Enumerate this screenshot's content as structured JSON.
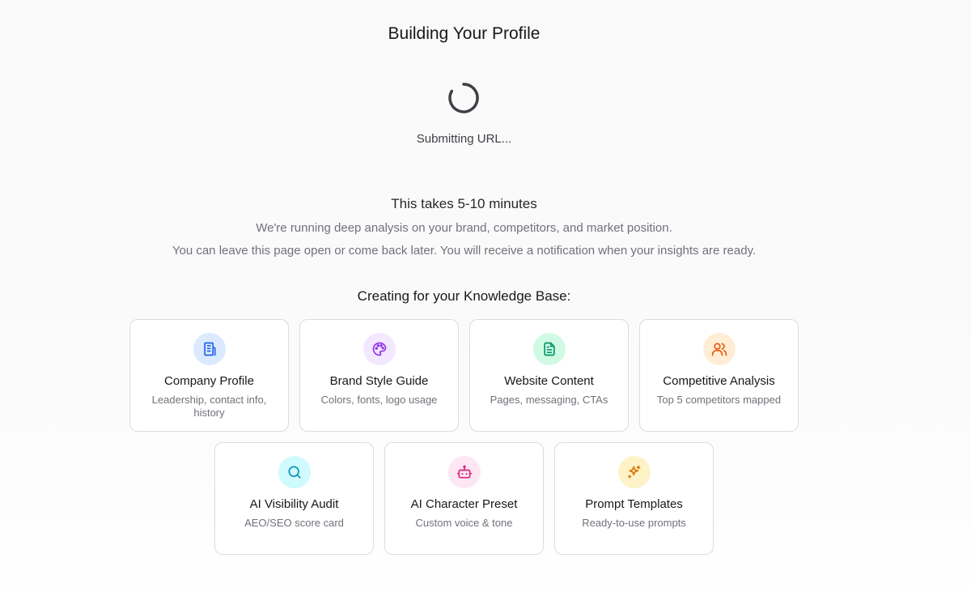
{
  "title": "Building Your Profile",
  "status": "Submitting URL...",
  "info": {
    "duration": "This takes 5-10 minutes",
    "line1": "We're running deep analysis on your brand, competitors, and market position.",
    "line2": "You can leave this page open or come back later. You will receive a notification when your insights are ready."
  },
  "knowledge_base": {
    "heading": "Creating for your Knowledge Base:",
    "items": [
      {
        "title": "Company Profile",
        "subtitle": "Leadership, contact info, history",
        "icon": "building-icon",
        "color": "#2563eb",
        "bg": "#dbeafe"
      },
      {
        "title": "Brand Style Guide",
        "subtitle": "Colors, fonts, logo usage",
        "icon": "palette-icon",
        "color": "#9333ea",
        "bg": "#f3e8ff"
      },
      {
        "title": "Website Content",
        "subtitle": "Pages, messaging, CTAs",
        "icon": "document-icon",
        "color": "#059669",
        "bg": "#d1fae5"
      },
      {
        "title": "Competitive Analysis",
        "subtitle": "Top 5 competitors mapped",
        "icon": "users-icon",
        "color": "#ea580c",
        "bg": "#ffedd5"
      },
      {
        "title": "AI Visibility Audit",
        "subtitle": "AEO/SEO score card",
        "icon": "search-icon",
        "color": "#0891b2",
        "bg": "#cffafe"
      },
      {
        "title": "AI Character Preset",
        "subtitle": "Custom voice & tone",
        "icon": "robot-icon",
        "color": "#db2777",
        "bg": "#fce7f3"
      },
      {
        "title": "Prompt Templates",
        "subtitle": "Ready-to-use prompts",
        "icon": "sparkles-icon",
        "color": "#d97706",
        "bg": "#fef3c7"
      }
    ]
  }
}
